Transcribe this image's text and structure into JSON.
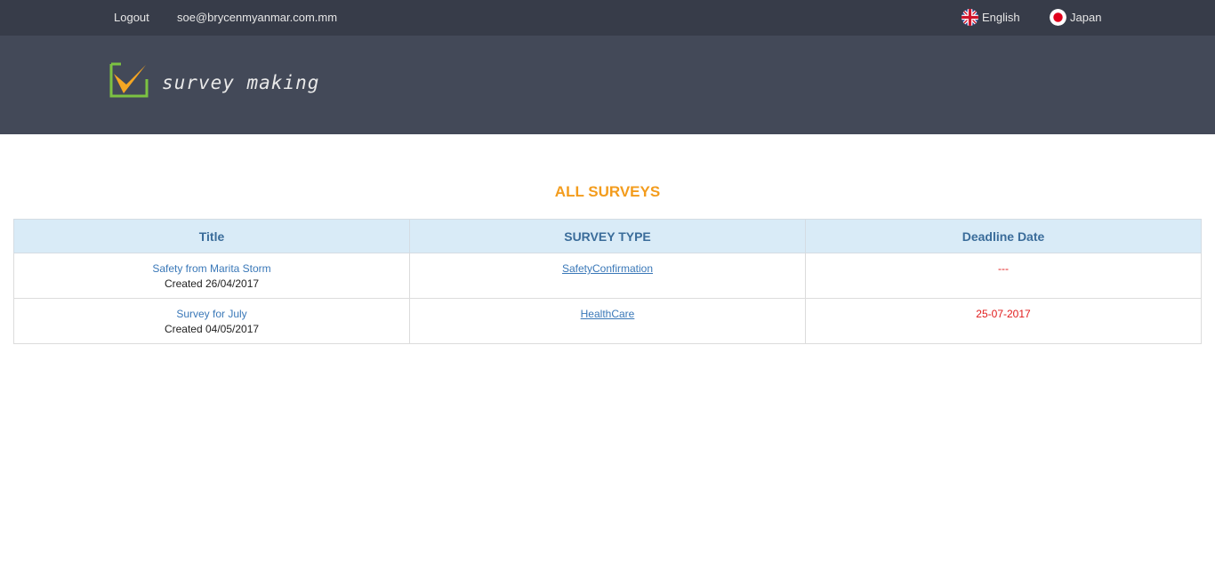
{
  "topbar": {
    "logout_label": "Logout",
    "user_email": "soe@brycenmyanmar.com.mm",
    "languages": [
      {
        "label": "English",
        "icon": "uk-flag-icon"
      },
      {
        "label": "Japan",
        "icon": "japan-flag-icon"
      }
    ]
  },
  "brand": {
    "logo_text": "survey making",
    "colors": {
      "check_orange": "#f5a623",
      "frame_green": "#7cc242"
    }
  },
  "main": {
    "title": "ALL SURVEYS",
    "columns": [
      "Title",
      "SURVEY TYPE",
      "Deadline Date"
    ],
    "rows": [
      {
        "title": "Safety from Marita Storm",
        "created": "Created 26/04/2017",
        "type": "SafetyConfirmation",
        "deadline": "---"
      },
      {
        "title": "Survey for July",
        "created": "Created 04/05/2017",
        "type": "HealthCare",
        "deadline": "25-07-2017"
      }
    ]
  },
  "colors": {
    "topbar": "#373c49",
    "banner": "#434958",
    "title_orange": "#f39c1d",
    "header_bg": "#d9ebf7",
    "link_blue": "#3a78b8",
    "deadline_red": "#e11b1b"
  }
}
